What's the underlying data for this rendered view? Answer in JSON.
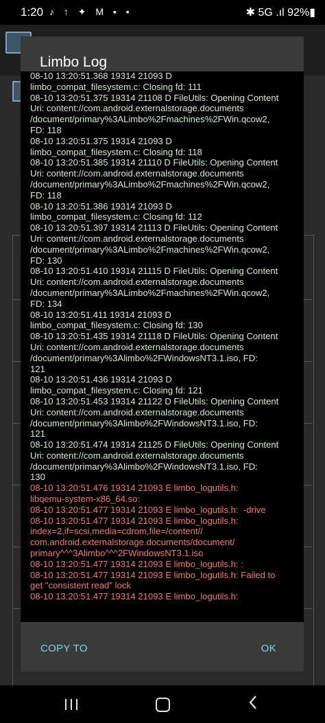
{
  "status_bar": {
    "time": "1:20",
    "notification_icons": "♪ ↑ ✦ M ▪ •",
    "right": "✱ 5G .ıl 92%▮"
  },
  "dialog": {
    "title": "Limbo Log",
    "log_lines": [
      {
        "text": "08-10 13:20:51.368 19314 21093 D",
        "level": "info"
      },
      {
        "text": "limbo_compat_filesystem.c: Closing fd: 111",
        "level": "info"
      },
      {
        "text": "08-10 13:20:51.375 19314 21108 D FileUtils: Opening Content",
        "level": "info"
      },
      {
        "text": "Uri: content://com.android.externalstorage.documents",
        "level": "info"
      },
      {
        "text": "/document/primary%3ALimbo%2Fmachines%2FWin.qcow2,",
        "level": "info"
      },
      {
        "text": "FD: 118",
        "level": "info"
      },
      {
        "text": "08-10 13:20:51.375 19314 21093 D",
        "level": "info"
      },
      {
        "text": "limbo_compat_filesystem.c: Closing fd: 118",
        "level": "info"
      },
      {
        "text": "08-10 13:20:51.385 19314 21110 D FileUtils: Opening Content",
        "level": "info"
      },
      {
        "text": "Uri: content://com.android.externalstorage.documents",
        "level": "info"
      },
      {
        "text": "/document/primary%3ALimbo%2Fmachines%2FWin.qcow2,",
        "level": "info"
      },
      {
        "text": "FD: 118",
        "level": "info"
      },
      {
        "text": "08-10 13:20:51.386 19314 21093 D",
        "level": "info"
      },
      {
        "text": "limbo_compat_filesystem.c: Closing fd: 112",
        "level": "info"
      },
      {
        "text": "08-10 13:20:51.397 19314 21113 D FileUtils: Opening Content",
        "level": "info"
      },
      {
        "text": "Uri: content://com.android.externalstorage.documents",
        "level": "info"
      },
      {
        "text": "/document/primary%3ALimbo%2Fmachines%2FWin.qcow2,",
        "level": "info"
      },
      {
        "text": "FD: 130",
        "level": "info"
      },
      {
        "text": "08-10 13:20:51.410 19314 21115 D FileUtils: Opening Content",
        "level": "info"
      },
      {
        "text": "Uri: content://com.android.externalstorage.documents",
        "level": "info"
      },
      {
        "text": "/document/primary%3ALimbo%2Fmachines%2FWin.qcow2,",
        "level": "info"
      },
      {
        "text": "FD: 134",
        "level": "info"
      },
      {
        "text": "08-10 13:20:51.411 19314 21093 D",
        "level": "info"
      },
      {
        "text": "limbo_compat_filesystem.c: Closing fd: 130",
        "level": "info"
      },
      {
        "text": "08-10 13:20:51.435 19314 21118 D FileUtils: Opening Content",
        "level": "info"
      },
      {
        "text": "Uri: content://com.android.externalstorage.documents",
        "level": "info"
      },
      {
        "text": "/document/primary%3Alimbo%2FWindowsNT3.1.iso, FD:",
        "level": "info"
      },
      {
        "text": "121",
        "level": "info"
      },
      {
        "text": "08-10 13:20:51.436 19314 21093 D",
        "level": "info"
      },
      {
        "text": "limbo_compat_filesystem.c: Closing fd: 121",
        "level": "info"
      },
      {
        "text": "08-10 13:20:51.453 19314 21122 D FileUtils: Opening Content",
        "level": "info"
      },
      {
        "text": "Uri: content://com.android.externalstorage.documents",
        "level": "info"
      },
      {
        "text": "/document/primary%3Alimbo%2FWindowsNT3.1.iso, FD:",
        "level": "info"
      },
      {
        "text": "121",
        "level": "info"
      },
      {
        "text": "08-10 13:20:51.474 19314 21125 D FileUtils: Opening Content",
        "level": "info"
      },
      {
        "text": "Uri: content://com.android.externalstorage.documents",
        "level": "info"
      },
      {
        "text": "/document/primary%3Alimbo%2FWindowsNT3.1.iso, FD:",
        "level": "info"
      },
      {
        "text": "130",
        "level": "info"
      },
      {
        "text": "08-10 13:20:51.476 19314 21093 E limbo_logutils.h:",
        "level": "error"
      },
      {
        "text": "libqemu-system-x86_64.so:",
        "level": "error"
      },
      {
        "text": "08-10 13:20:51.477 19314 21093 E limbo_logutils.h:  -drive",
        "level": "error"
      },
      {
        "text": "08-10 13:20:51.477 19314 21093 E limbo_logutils.h:",
        "level": "error"
      },
      {
        "text": "index=2,if=scsi,media=cdrom,file=/content//",
        "level": "error"
      },
      {
        "text": "com.android.externalstorage.documents/document/",
        "level": "error"
      },
      {
        "text": "primary^^^3Alimbo^^^2FWindowsNT3.1.iso",
        "level": "error"
      },
      {
        "text": "08-10 13:20:51.477 19314 21093 E limbo_logutils.h: :",
        "level": "error"
      },
      {
        "text": "08-10 13:20:51.477 19314 21093 E limbo_logutils.h: Failed to",
        "level": "error"
      },
      {
        "text": "get \"consistent read\" lock",
        "level": "error"
      },
      {
        "text": "08-10 13:20:51.477 19314 21093 E limbo_logutils.h:",
        "level": "error"
      }
    ],
    "copy_button_label": "COPY TO",
    "ok_button_label": "OK"
  },
  "colors": {
    "log_info": "#d4ebd2",
    "log_error": "#f07878",
    "button_accent": "#7fd3e0",
    "dialog_header": "#3a3a3a"
  },
  "nav_bar": {
    "icons": [
      "recent-apps-icon",
      "home-icon",
      "back-icon"
    ]
  }
}
